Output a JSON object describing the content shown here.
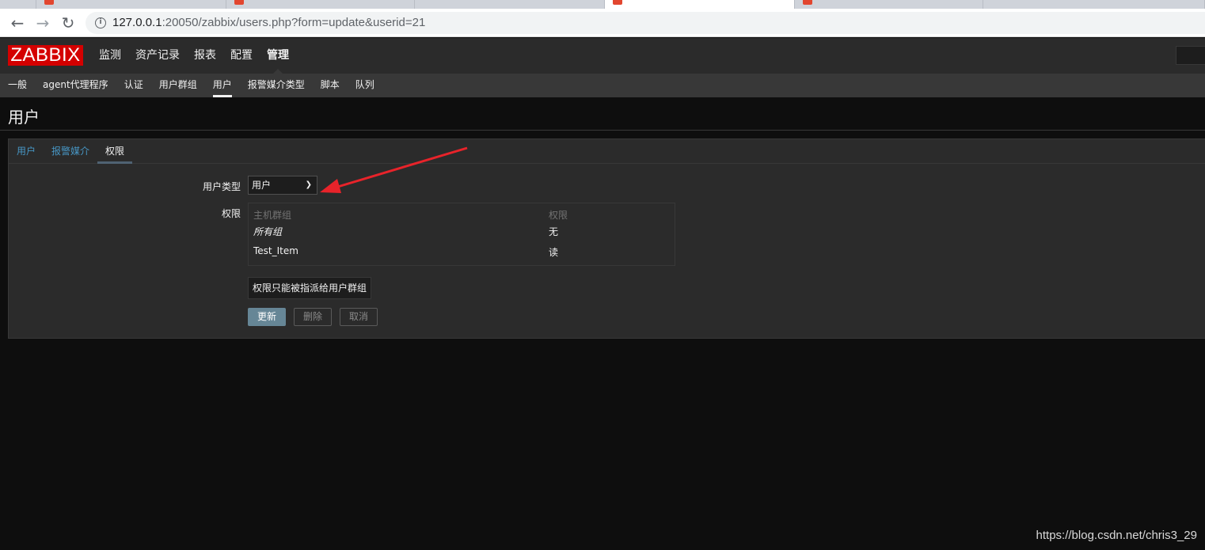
{
  "browser": {
    "url_host": "127.0.0.1",
    "url_rest": ":20050/zabbix/users.php?form=update&userid=21"
  },
  "topnav": {
    "logo": "ZABBIX",
    "menu": [
      {
        "label": "监测"
      },
      {
        "label": "资产记录"
      },
      {
        "label": "报表"
      },
      {
        "label": "配置"
      },
      {
        "label": "管理"
      }
    ]
  },
  "subnav": {
    "items": [
      {
        "label": "一般"
      },
      {
        "label": "agent代理程序"
      },
      {
        "label": "认证"
      },
      {
        "label": "用户群组"
      },
      {
        "label": "用户"
      },
      {
        "label": "报警媒介类型"
      },
      {
        "label": "脚本"
      },
      {
        "label": "队列"
      }
    ]
  },
  "page": {
    "title": "用户"
  },
  "form": {
    "tabs": [
      {
        "label": "用户"
      },
      {
        "label": "报警媒介"
      },
      {
        "label": "权限"
      }
    ],
    "user_type_label": "用户类型",
    "user_type_value": "用户",
    "permissions_label": "权限",
    "table": {
      "col_hostgroup": "主机群组",
      "col_permission": "权限",
      "rows": [
        {
          "group": "所有组",
          "permission": "无"
        },
        {
          "group": "Test_Item",
          "permission": "读"
        }
      ]
    },
    "note": "权限只能被指派给用户群组",
    "buttons": {
      "update": "更新",
      "delete": "删除",
      "cancel": "取消"
    }
  },
  "watermark": "https://blog.csdn.net/chris3_29",
  "colors": {
    "logo_red": "#d40000",
    "link_blue": "#4796c4",
    "primary_button": "#668696",
    "annotation_arrow": "#e8232a"
  }
}
